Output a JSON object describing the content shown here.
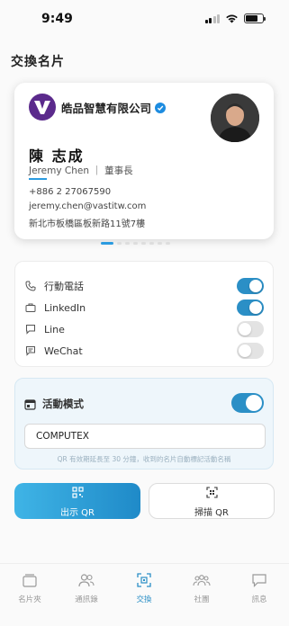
{
  "status_bar": {
    "time": "9:49"
  },
  "page_title": "交換名片",
  "card": {
    "company": "皓品智慧有限公司",
    "name": "陳 志成",
    "subtitle": "Jeremy Chen ｜ 董事長",
    "phone": "+886 2 27067590",
    "email": "jeremy.chen@vastitw.com",
    "address": "新北市板橋區板新路11號7樓"
  },
  "carousel": {
    "count": 8,
    "active_index": 0
  },
  "share_options": [
    {
      "icon": "phone-icon",
      "label": "行動電話",
      "enabled": true
    },
    {
      "icon": "briefcase-icon",
      "label": "LinkedIn",
      "enabled": true
    },
    {
      "icon": "chat-bubble-icon",
      "label": "Line",
      "enabled": false
    },
    {
      "icon": "message-icon",
      "label": "WeChat",
      "enabled": false
    }
  ],
  "event_mode": {
    "label": "活動模式",
    "enabled": true,
    "input_value": "COMPUTEX",
    "hint": "QR 有效期延長至 30 分鐘，收到的名片自動標記活動名稱"
  },
  "actions": {
    "show_qr": "出示 QR",
    "scan_qr": "掃描 QR"
  },
  "tabs": [
    {
      "icon": "card-stack-icon",
      "label": "名片夾"
    },
    {
      "icon": "contacts-icon",
      "label": "通訊錄"
    },
    {
      "icon": "qr-exchange-icon",
      "label": "交換",
      "active": true
    },
    {
      "icon": "community-icon",
      "label": "社團"
    },
    {
      "icon": "message-icon",
      "label": "訊息"
    }
  ],
  "colors": {
    "accent": "#2b8fc6",
    "brand": "#5b2a8c"
  }
}
